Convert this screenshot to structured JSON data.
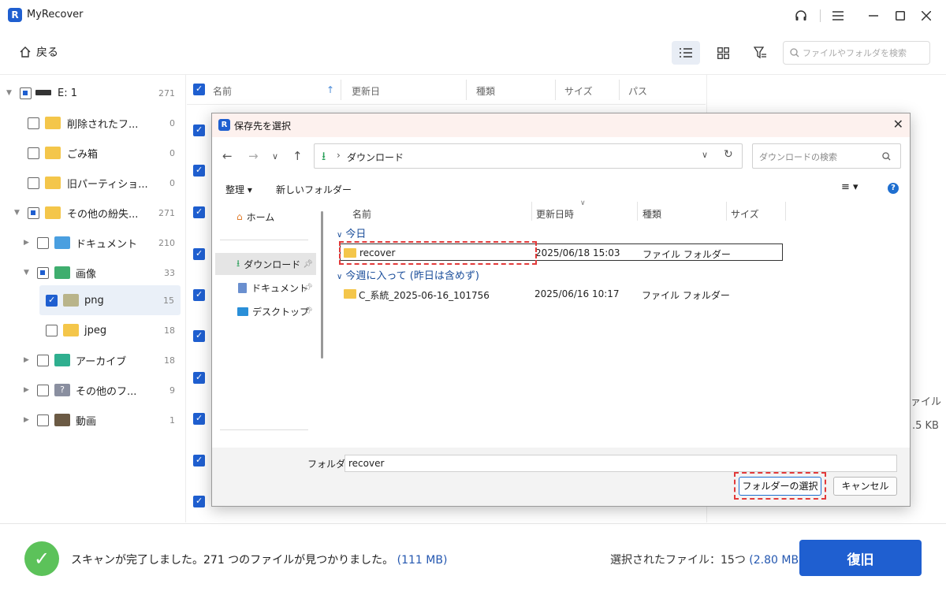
{
  "app": {
    "title": "MyRecover"
  },
  "toolbar": {
    "back_label": "戻る",
    "search_placeholder": "ファイルやフォルダを検索"
  },
  "tree": [
    {
      "label": "E: 1",
      "count": "271",
      "state": "partial",
      "expanded": true
    },
    {
      "label": "削除されたフ...",
      "count": "0",
      "state": "unchecked"
    },
    {
      "label": "ごみ箱",
      "count": "0",
      "state": "unchecked"
    },
    {
      "label": "旧パーティショ...",
      "count": "0",
      "state": "unchecked"
    },
    {
      "label": "その他の紛失...",
      "count": "271",
      "state": "partial",
      "expanded": true
    },
    {
      "label": "ドキュメント",
      "count": "210",
      "state": "unchecked"
    },
    {
      "label": "画像",
      "count": "33",
      "state": "partial",
      "expanded": true
    },
    {
      "label": "png",
      "count": "15",
      "state": "checked",
      "selected": true
    },
    {
      "label": "jpeg",
      "count": "18",
      "state": "unchecked"
    },
    {
      "label": "アーカイブ",
      "count": "18",
      "state": "unchecked"
    },
    {
      "label": "その他のフ...",
      "count": "9",
      "state": "unchecked"
    },
    {
      "label": "動画",
      "count": "1",
      "state": "unchecked"
    }
  ],
  "list": {
    "columns": [
      "名前",
      "更新日",
      "種類",
      "サイズ",
      "パス"
    ]
  },
  "right_panel": {
    "type_text": "ァイル",
    "size_text": ".5 KB"
  },
  "status": {
    "message": "スキャンが完了しました。271 つのファイルが見つかりました。",
    "total_size": "(111 MB)",
    "selected_label": "選択されたファイル：15つ",
    "selected_size": "(2.80 MB)",
    "restore_label": "復旧"
  },
  "dialog": {
    "title": "保存先を選択",
    "address": "ダウンロード",
    "search_placeholder": "ダウンロードの検索",
    "organize_label": "整理 ▾",
    "new_folder_label": "新しいフォルダー",
    "nav": {
      "home": "ホーム",
      "downloads": "ダウンロード",
      "documents": "ドキュメント",
      "desktop": "デスクトップ"
    },
    "columns": [
      "名前",
      "更新日時",
      "種類",
      "サイズ"
    ],
    "groups": [
      {
        "label": "今日",
        "rows": [
          {
            "name": "recover",
            "date": "2025/06/18 15:03",
            "type": "ファイル フォルダー"
          }
        ]
      },
      {
        "label": "今週に入って (昨日は含めず)",
        "rows": [
          {
            "name": "C_系統_2025-06-16_101756",
            "date": "2025/06/16 10:17",
            "type": "ファイル フォルダー"
          }
        ]
      }
    ],
    "folder_label": "フォルダー:",
    "folder_value": "recover",
    "select_label": "フォルダーの選択",
    "cancel_label": "キャンセル"
  }
}
